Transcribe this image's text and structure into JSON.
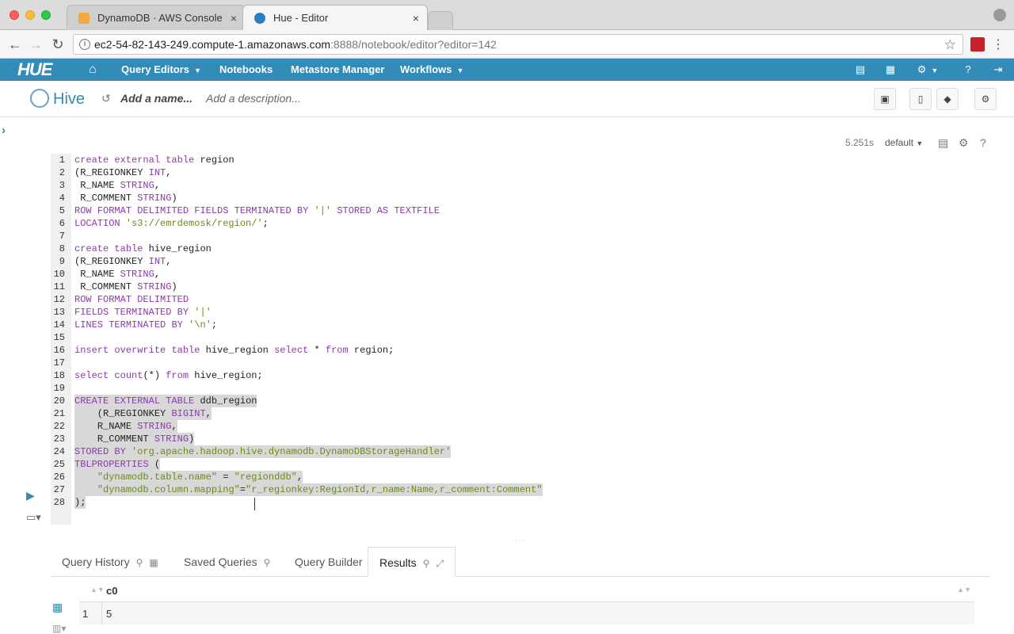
{
  "browser": {
    "tabs": [
      {
        "title": "DynamoDB · AWS Console",
        "close": "×"
      },
      {
        "title": "Hue - Editor",
        "close": "×"
      }
    ],
    "url_host": "ec2-54-82-143-249.compute-1.amazonaws.com",
    "url_path": ":8888/notebook/editor?editor=142"
  },
  "hue_nav": {
    "logo": "HUE",
    "items": [
      {
        "label": "Query Editors"
      },
      {
        "label": "Notebooks"
      },
      {
        "label": "Metastore Manager"
      },
      {
        "label": "Workflows"
      }
    ]
  },
  "editor_header": {
    "title": "Hive",
    "name_placeholder": "Add a name...",
    "description_placeholder": "Add a description..."
  },
  "snippet_meta": {
    "duration": "5.251s",
    "database": "default"
  },
  "code_lines": [
    {
      "n": "1",
      "text": "create external table region",
      "selected": false
    },
    {
      "n": "2",
      "text": "(R_REGIONKEY INT,",
      "selected": false
    },
    {
      "n": "3",
      "text": " R_NAME STRING,",
      "selected": false
    },
    {
      "n": "4",
      "text": " R_COMMENT STRING)",
      "selected": false
    },
    {
      "n": "5",
      "text": "ROW FORMAT DELIMITED FIELDS TERMINATED BY '|' STORED AS TEXTFILE",
      "selected": false
    },
    {
      "n": "6",
      "text": "LOCATION 's3://emrdemosk/region/';",
      "selected": false
    },
    {
      "n": "7",
      "text": "",
      "selected": false
    },
    {
      "n": "8",
      "text": "create table hive_region",
      "selected": false
    },
    {
      "n": "9",
      "text": "(R_REGIONKEY INT,",
      "selected": false
    },
    {
      "n": "10",
      "text": " R_NAME STRING,",
      "selected": false
    },
    {
      "n": "11",
      "text": " R_COMMENT STRING)",
      "selected": false
    },
    {
      "n": "12",
      "text": "ROW FORMAT DELIMITED",
      "selected": false
    },
    {
      "n": "13",
      "text": "FIELDS TERMINATED BY '|'",
      "selected": false
    },
    {
      "n": "14",
      "text": "LINES TERMINATED BY '\\n';",
      "selected": false
    },
    {
      "n": "15",
      "text": "",
      "selected": false
    },
    {
      "n": "16",
      "text": "insert overwrite table hive_region select * from region;",
      "selected": false
    },
    {
      "n": "17",
      "text": "",
      "selected": false
    },
    {
      "n": "18",
      "text": "select count(*) from hive_region;",
      "selected": false
    },
    {
      "n": "19",
      "text": "",
      "selected": false
    },
    {
      "n": "20",
      "text": "CREATE EXTERNAL TABLE ddb_region",
      "selected": true
    },
    {
      "n": "21",
      "text": "    (R_REGIONKEY BIGINT,",
      "selected": true
    },
    {
      "n": "22",
      "text": "    R_NAME STRING,",
      "selected": true
    },
    {
      "n": "23",
      "text": "    R_COMMENT STRING)",
      "selected": true
    },
    {
      "n": "24",
      "text": "STORED BY 'org.apache.hadoop.hive.dynamodb.DynamoDBStorageHandler'",
      "selected": true
    },
    {
      "n": "25",
      "text": "TBLPROPERTIES (",
      "selected": true
    },
    {
      "n": "26",
      "text": "    \"dynamodb.table.name\" = \"regionddb\",",
      "selected": true
    },
    {
      "n": "27",
      "text": "    \"dynamodb.column.mapping\"=\"r_regionkey:RegionId,r_name:Name,r_comment:Comment\"",
      "selected": true
    },
    {
      "n": "28",
      "text": ");",
      "selected": true
    }
  ],
  "bottom_tabs": [
    {
      "label": "Query History"
    },
    {
      "label": "Saved Queries"
    },
    {
      "label": "Query Builder"
    },
    {
      "label": "Results"
    }
  ],
  "results": {
    "columns": [
      "c0"
    ],
    "rows": [
      {
        "n": "1",
        "values": [
          "5"
        ]
      }
    ]
  }
}
